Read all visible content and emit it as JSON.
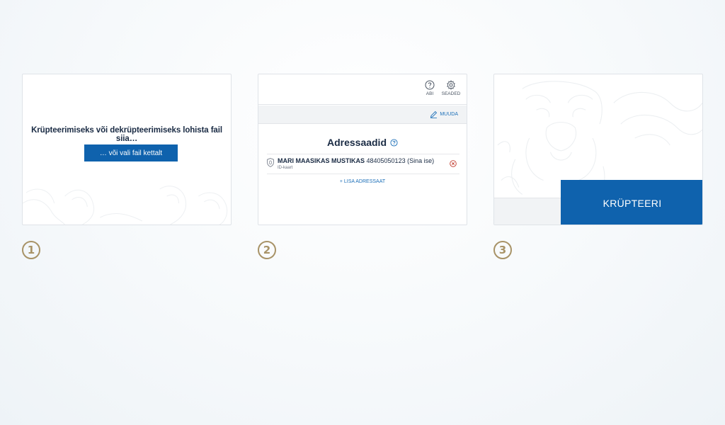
{
  "panel1": {
    "drop_text": "Krüpteerimiseks või dekrüpteerimiseks lohista fail siia…",
    "choose_file_label": "… või vali fail kettalt"
  },
  "panel2": {
    "help_label": "ABI",
    "settings_label": "SEADED",
    "edit_label": "MUUDA",
    "title": "Adressaadid",
    "recipients": [
      {
        "name": "MARI MAASIKAS MUSTIKAS",
        "code": "48405050123 (Sina ise)",
        "type": "ID-kaart"
      }
    ],
    "add_recipient_label": "+ LISA ADRESSAAT"
  },
  "panel3": {
    "encrypt_label": "KRÜPTEERI"
  },
  "steps": [
    "1",
    "2",
    "3"
  ],
  "colors": {
    "primary": "#0f62ad",
    "link": "#1c6fb8",
    "step_gold": "#a89367",
    "remove_red": "#c0392b"
  },
  "icons": {
    "help": "question-circle-icon",
    "settings": "gear-icon",
    "edit": "pencil-icon",
    "info": "info-circle-icon",
    "id_card": "shield-icon",
    "remove": "close-circle-icon"
  }
}
